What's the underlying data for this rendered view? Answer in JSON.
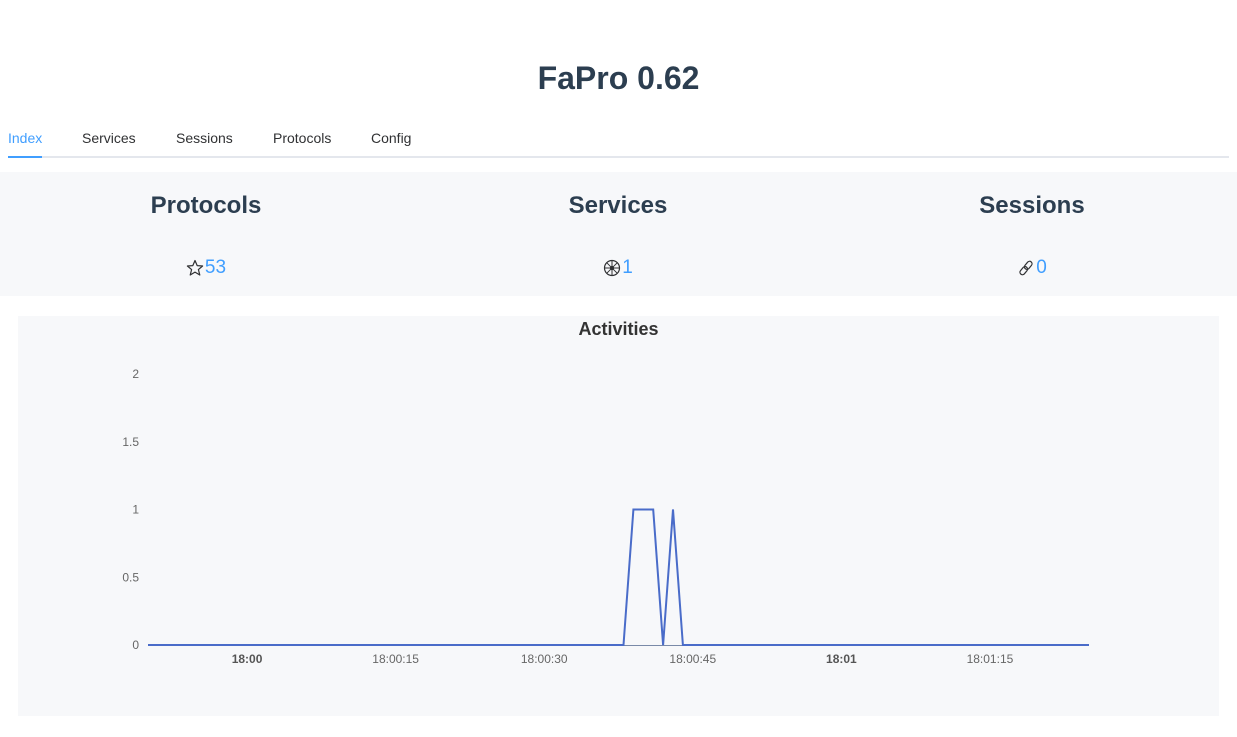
{
  "app": {
    "title": "FaPro 0.62"
  },
  "tabs": [
    {
      "label": "Index",
      "active": true
    },
    {
      "label": "Services",
      "active": false
    },
    {
      "label": "Sessions",
      "active": false
    },
    {
      "label": "Protocols",
      "active": false
    },
    {
      "label": "Config",
      "active": false
    }
  ],
  "stats": [
    {
      "title": "Protocols",
      "value": "53",
      "icon": "star-icon"
    },
    {
      "title": "Services",
      "value": "1",
      "icon": "wheel-icon"
    },
    {
      "title": "Sessions",
      "value": "0",
      "icon": "link-icon"
    }
  ],
  "colors": {
    "accent": "#409eff",
    "series": "#4a6cc9",
    "panel": "#f7f8fa"
  },
  "chart_data": {
    "type": "line",
    "title": "Activities",
    "xlabel": "",
    "ylabel": "",
    "ylim": [
      0,
      2
    ],
    "yticks": [
      0,
      0.5,
      1,
      1.5,
      2
    ],
    "xlim": [
      "17:59:50",
      "18:01:25"
    ],
    "xticks": [
      {
        "t": "18:00:00",
        "label": "18:00",
        "major": true
      },
      {
        "t": "18:00:15",
        "label": "18:00:15",
        "major": false
      },
      {
        "t": "18:00:30",
        "label": "18:00:30",
        "major": false
      },
      {
        "t": "18:00:45",
        "label": "18:00:45",
        "major": false
      },
      {
        "t": "18:01:00",
        "label": "18:01",
        "major": true
      },
      {
        "t": "18:01:15",
        "label": "18:01:15",
        "major": false
      }
    ],
    "grid": false,
    "legend": "none",
    "series": [
      {
        "points": [
          [
            "17:59:50",
            0
          ],
          [
            "18:00:38",
            0
          ],
          [
            "18:00:39",
            1
          ],
          [
            "18:00:41",
            1
          ],
          [
            "18:00:42",
            0
          ],
          [
            "18:00:43",
            1
          ],
          [
            "18:00:44",
            0
          ],
          [
            "18:01:25",
            0
          ]
        ]
      }
    ]
  }
}
